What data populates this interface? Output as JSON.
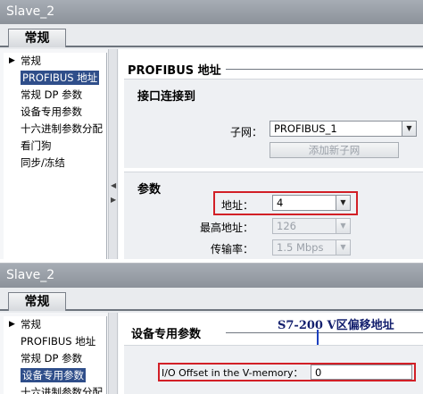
{
  "panel1": {
    "window_title": "Slave_2",
    "tab_label": "常规",
    "nav_items": [
      {
        "label": "常规",
        "expandable": true,
        "selected": false
      },
      {
        "label": "PROFIBUS 地址",
        "selected": true
      },
      {
        "label": "常规 DP 参数",
        "selected": false
      },
      {
        "label": "设备专用参数",
        "selected": false
      },
      {
        "label": "十六进制参数分配",
        "selected": false
      },
      {
        "label": "看门狗",
        "selected": false
      },
      {
        "label": "同步/冻结",
        "selected": false
      }
    ],
    "section_title": "PROFIBUS 地址",
    "interface": {
      "title": "接口连接到",
      "subnet_label": "子网：",
      "subnet_value": "PROFIBUS_1",
      "add_subnet_button": "添加新子网"
    },
    "params": {
      "title": "参数",
      "address_label": "地址：",
      "address_value": "4",
      "max_address_label": "最高地址：",
      "max_address_value": "126",
      "baud_label": "传输率：",
      "baud_value": "1.5 Mbps"
    },
    "highlight_color": "#d21f26"
  },
  "panel2": {
    "window_title": "Slave_2",
    "tab_label": "常规",
    "nav_items": [
      {
        "label": "常规",
        "expandable": true,
        "selected": false
      },
      {
        "label": "PROFIBUS 地址",
        "selected": false
      },
      {
        "label": "常规 DP 参数",
        "selected": false
      },
      {
        "label": "设备专用参数",
        "selected": true
      },
      {
        "label": "十六进制参数分配",
        "selected": false
      }
    ],
    "section_title": "设备专用参数",
    "io_offset_label": "I/O Offset in the V-memory：",
    "io_offset_value": "0",
    "annotation": "S7-200 V区偏移地址",
    "annotation_color": "#1b3fbf"
  }
}
